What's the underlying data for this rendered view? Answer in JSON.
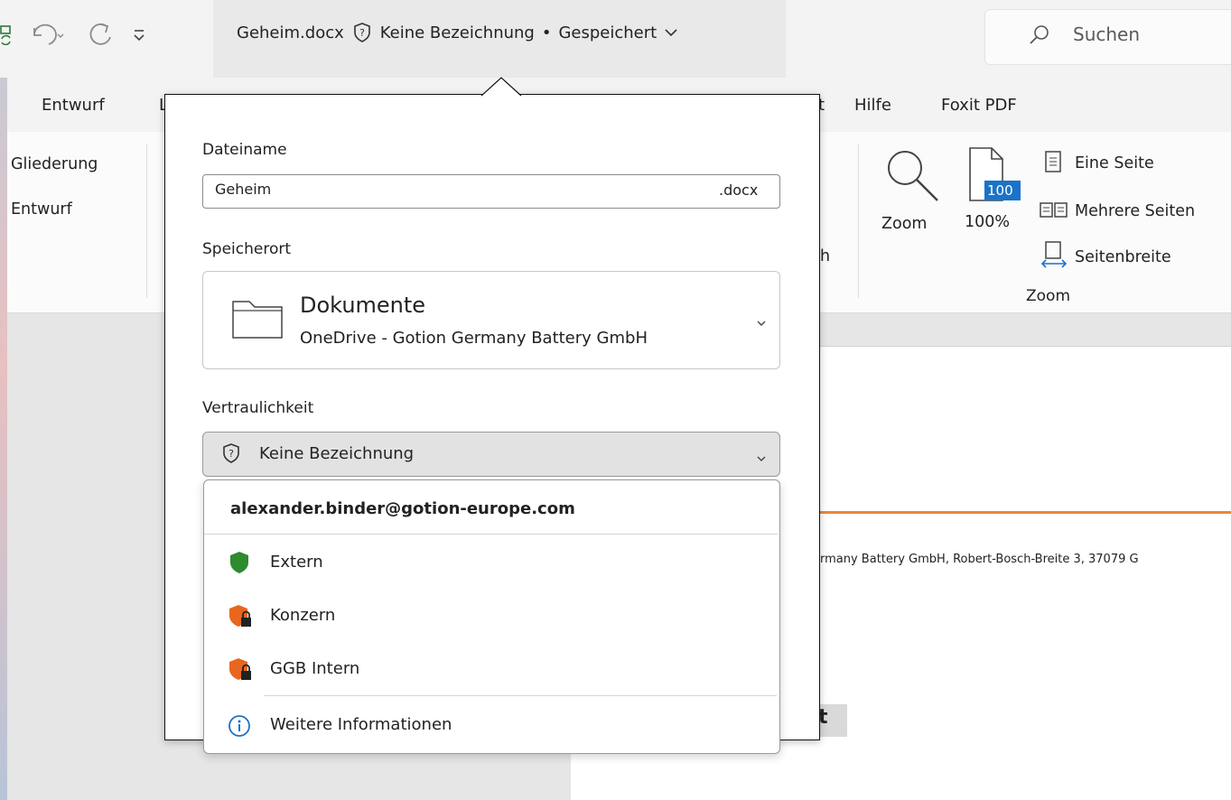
{
  "titlebar": {
    "filename": "Geheim.docx",
    "label_status": "Keine Bezeichnung",
    "separator": "•",
    "save_status": "Gespeichert",
    "search_placeholder": "Suchen"
  },
  "tabs": [
    {
      "label": "Entwurf"
    },
    {
      "label": "L"
    },
    {
      "label": "t"
    },
    {
      "label": "Hilfe"
    },
    {
      "label": "Foxit PDF"
    }
  ],
  "ribbon": {
    "views": [
      "Gliederung",
      "Entwurf"
    ],
    "partial_text": "h",
    "zoom_button": "Zoom",
    "zoom_percent_icon": "100",
    "zoom_percent": "100%",
    "one_page": "Eine Seite",
    "multiple_pages": "Mehrere Seiten",
    "page_width": "Seitenbreite",
    "group_zoom": "Zoom"
  },
  "document": {
    "address_text": "rmany Battery GmbH, Robert-Bosch-Breite 3, 37079 G",
    "partial_char": "t",
    "accent_color": "#e8873a"
  },
  "popup": {
    "filename_label": "Dateiname",
    "filename_value": "Geheim",
    "extension": ".docx",
    "location_label": "Speicherort",
    "location_title": "Dokumente",
    "location_sub": "OneDrive - Gotion Germany Battery GmbH",
    "sensitivity_label": "Vertraulichkeit",
    "sensitivity_value": "Keine Bezeichnung"
  },
  "dropdown": {
    "account": "alexander.binder@gotion-europe.com",
    "items": [
      {
        "label": "Extern",
        "icon": "shield-green-icon",
        "color": "#2e8b2e"
      },
      {
        "label": "Konzern",
        "icon": "shield-lock-orange-icon",
        "color": "#e8661e"
      },
      {
        "label": "GGB Intern",
        "icon": "shield-lock-orange-icon",
        "color": "#e8661e"
      }
    ],
    "more_info": "Weitere Informationen",
    "info_color": "#1a73c8"
  }
}
